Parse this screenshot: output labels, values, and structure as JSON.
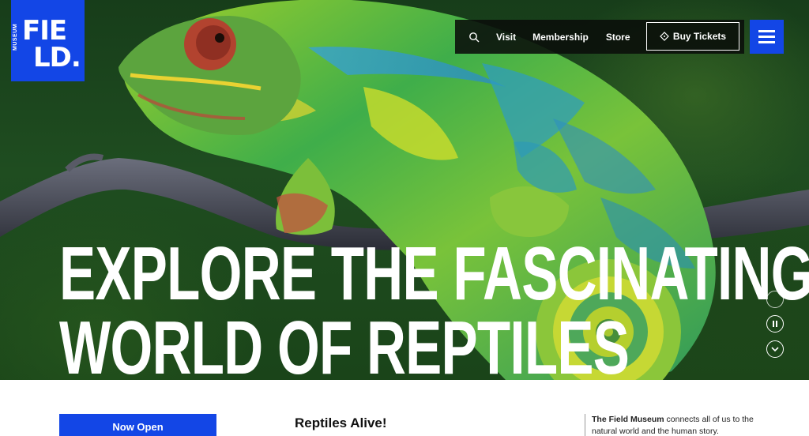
{
  "logo": {
    "line1": "FIE",
    "line2": "LD.",
    "side": "MUSEUM"
  },
  "nav": {
    "search_icon": "search-icon",
    "links": [
      "Visit",
      "Membership",
      "Store"
    ],
    "buy_tickets": "Buy Tickets",
    "ticket_icon": "ticket-icon"
  },
  "menu_icon": "hamburger-menu-icon",
  "hero": {
    "headline_line1": "EXPLORE THE FASCINATING",
    "headline_line2": "WORLD OF REPTILES"
  },
  "carousel_controls": {
    "dot_icon": "slide-indicator-icon",
    "pause_icon": "pause-icon",
    "scroll_icon": "chevron-down-icon"
  },
  "content": {
    "now_open_label": "Now Open",
    "section_title": "Reptiles Alive!",
    "about_bold": "The Field Museum",
    "about_rest": " connects all of us to the natural world and the human story."
  },
  "colors": {
    "brand_blue": "#1346e6",
    "nav_bg": "#0a0e0a"
  }
}
